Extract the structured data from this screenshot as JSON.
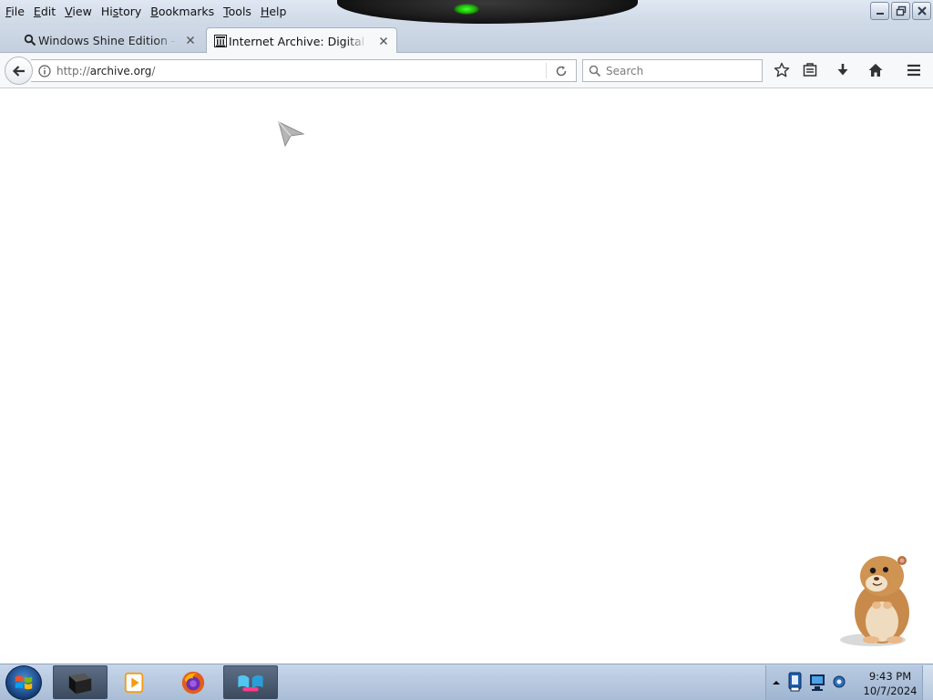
{
  "menu": {
    "file": {
      "key": "F",
      "rest": "ile"
    },
    "edit": {
      "key": "E",
      "rest": "dit"
    },
    "view": {
      "key": "V",
      "rest": "iew"
    },
    "history": {
      "pre": "Hi",
      "key": "s",
      "rest": "tory"
    },
    "bookmarks": {
      "key": "B",
      "rest": "ookmarks"
    },
    "tools": {
      "key": "T",
      "rest": "ools"
    },
    "help": {
      "key": "H",
      "rest": "elp"
    }
  },
  "tabs": [
    {
      "label": "Windows Shine Edition - Windows",
      "icon": "search-icon"
    },
    {
      "label": "Internet Archive: Digital Library",
      "icon": "archive-icon",
      "active": true
    }
  ],
  "urlbar": {
    "scheme": "http://",
    "host": "archive.org",
    "path": "/"
  },
  "search": {
    "placeholder": "Search"
  },
  "toolbar_icons": [
    "star-icon",
    "reading-list-icon",
    "download-icon",
    "home-icon",
    "menu-icon"
  ],
  "taskbar": {
    "apps": [
      "black-window-app",
      "media-player-app",
      "firefox-app",
      "windows-live-app"
    ],
    "clock_time": "9:43 PM",
    "clock_date": "10/7/2024"
  },
  "colors": {
    "taskbar": "#b4c6dd",
    "tabbar": "#c9d4e3",
    "active_tab": "#f7f8fa",
    "ornament_glow": "#22cc00"
  }
}
